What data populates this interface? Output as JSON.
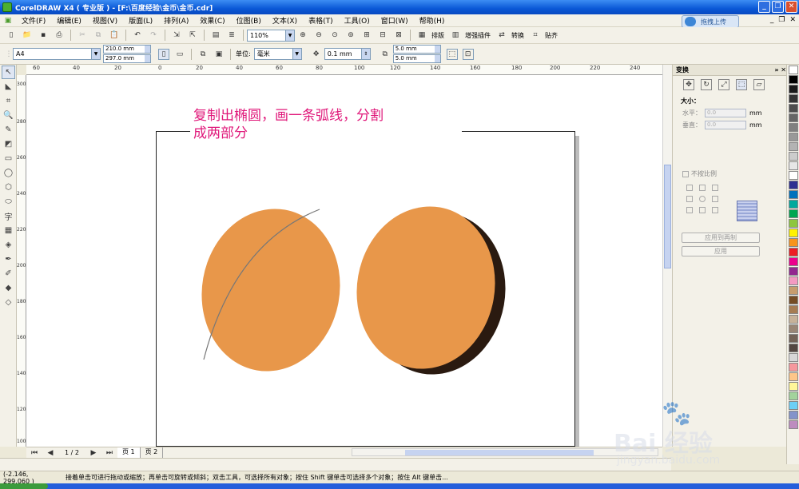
{
  "window": {
    "title": "CorelDRAW X4 ( 专业版 ) - [F:\\百度经验\\金币\\金币.cdr]"
  },
  "menu": [
    "文件(F)",
    "编辑(E)",
    "视图(V)",
    "版面(L)",
    "排列(A)",
    "效果(C)",
    "位图(B)",
    "文本(X)",
    "表格(T)",
    "工具(O)",
    "窗口(W)",
    "帮助(H)"
  ],
  "baidu_upload": "拖拽上传",
  "toolbar": {
    "zoom": "110%",
    "labels": [
      "排版",
      "增强插件",
      "转换",
      "贴齐"
    ]
  },
  "property_bar": {
    "paper": "A4",
    "width": "210.0 mm",
    "height": "297.0 mm",
    "unit_label": "单位:",
    "unit": "毫米",
    "nudge": "0.1 mm",
    "dup_x": "5.0 mm",
    "dup_y": "5.0 mm"
  },
  "ruler_top": [
    "60",
    "40",
    "20",
    "0",
    "20",
    "40",
    "60",
    "80",
    "100",
    "120",
    "140",
    "160",
    "180",
    "200",
    "220",
    "240"
  ],
  "ruler_left": [
    "300",
    "280",
    "260",
    "240",
    "220",
    "200",
    "180",
    "160",
    "140",
    "120",
    "100"
  ],
  "annotation": {
    "line1": "复制出椭圆，画一条弧线，分割",
    "line2": "成两部分"
  },
  "shapes": {
    "fill": "#e8974a",
    "shadow": "#2a1a10",
    "arc_color": "#777777"
  },
  "page_tabs": {
    "counter": "1 / 2",
    "pages": [
      "页 1",
      "页 2"
    ]
  },
  "docker": {
    "title": "变换",
    "size_label": "大小：",
    "h_label": "水平：",
    "h_value": "0.0",
    "v_label": "垂直：",
    "v_value": "0.0",
    "unit": "mm",
    "proportional": "不按比例",
    "apply_dup": "应用到再制",
    "apply": "应用"
  },
  "palette": [
    "#ffffff",
    "#000000",
    "#1a1a1a",
    "#333333",
    "#4d4d4d",
    "#666666",
    "#808080",
    "#999999",
    "#b3b3b3",
    "#cccccc",
    "#e6e6e6",
    "#ffffff",
    "#2e3192",
    "#0072bc",
    "#00a99d",
    "#00a651",
    "#8dc63f",
    "#fff200",
    "#f7941d",
    "#ed1c24",
    "#ec008c",
    "#92278f",
    "#f49ac1",
    "#c69c6d",
    "#754c24",
    "#a67c52",
    "#c7b299",
    "#998675",
    "#736357",
    "#534741",
    "#d7d7d7",
    "#f5989d",
    "#fdc689",
    "#fff799",
    "#a3d39c",
    "#6dcff6",
    "#8393ca",
    "#bd8cbf"
  ],
  "status": {
    "coord": "(-2.146, 299.060 )",
    "message": "接着单击可进行拖动或缩放；再单击可旋转或倾斜；双击工具，可选择所有对象；按住 Shift 键单击可选择多个对象；按住 Alt 键单击..."
  },
  "watermark": {
    "brand": "Bai 经验",
    "url": "jingyan.baidu.com"
  }
}
